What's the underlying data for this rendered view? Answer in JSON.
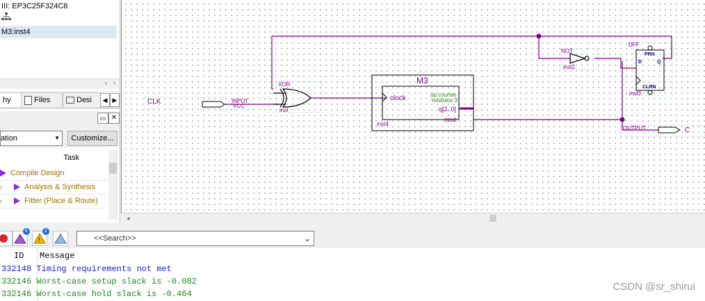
{
  "project": {
    "device_label": "III: EP3C25F324C8",
    "hierarchy_icon": "hierarchy-icon",
    "selected_entity": "M3:inst4"
  },
  "tabs": [
    {
      "label": "hy"
    },
    {
      "label": "Files"
    },
    {
      "label": "Desi"
    }
  ],
  "tasks": {
    "flow_combo_value": "ation",
    "customize_label": "Customize...",
    "column_header": "Task",
    "items": [
      {
        "label": "Compile Design"
      },
      {
        "label": "Analysis & Synthesis"
      },
      {
        "label": "Fitter (Place & Route)"
      }
    ]
  },
  "schematic": {
    "input_pin": {
      "name": "CLK",
      "type": "INPUT",
      "default": "VCC"
    },
    "xor": {
      "type": "XOR",
      "inst": "inst"
    },
    "counter": {
      "title": "M3",
      "port_clock": "clock",
      "desc1": "up counter",
      "desc2": "modulus 3",
      "port_q": "q[2..0]",
      "port_cout": "cout",
      "inst": "inst4"
    },
    "not_gate": {
      "type": "NOT",
      "inst": "inst2"
    },
    "dff": {
      "type": "DFF",
      "prn": "PRN",
      "d": "D",
      "q": "Q",
      "clrn": "CLRN",
      "inst": "inst3"
    },
    "output_pin": {
      "type": "OUTPUT",
      "name": "C"
    }
  },
  "messages": {
    "filter_badges": {
      "critical_warning": "6",
      "warning": "2"
    },
    "search_placeholder": "<<Search>>",
    "col_id": "ID",
    "col_message": "Message",
    "rows": [
      {
        "id": "332148",
        "text": "Timing requirements not met",
        "color": "#1a1ad0"
      },
      {
        "id": "332146",
        "text": "Worst-case setup slack is -0.082",
        "color": "#1a8a1a"
      },
      {
        "id": "332146",
        "text": "Worst-case hold slack is -0.464",
        "color": "#1a8a1a"
      }
    ]
  },
  "watermark": "CSDN @sr_shirui",
  "colors": {
    "wire": "#800080",
    "component": "#000000"
  }
}
